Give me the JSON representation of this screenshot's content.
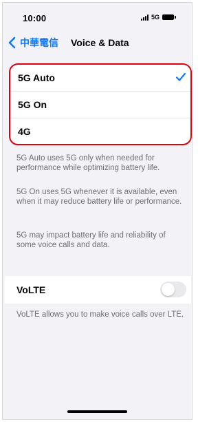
{
  "status_bar": {
    "time": "10:00",
    "network": "5G",
    "signal_icon": "signal-bars-icon",
    "battery_icon": "battery-icon"
  },
  "nav": {
    "back_label": "中華電信",
    "back_icon": "chevron-left-icon",
    "title": "Voice & Data"
  },
  "options": [
    {
      "label": "5G Auto",
      "selected": true
    },
    {
      "label": "5G On",
      "selected": false
    },
    {
      "label": "4G",
      "selected": false
    }
  ],
  "footnotes": {
    "auto": "5G Auto uses 5G only when needed for performance while optimizing battery life.",
    "on": "5G On uses 5G whenever it is available, even when it may reduce battery life or performance.",
    "impact": "5G may impact battery life and reliability of some voice calls and data."
  },
  "volte": {
    "label": "VoLTE",
    "enabled": false,
    "footnote": "VoLTE allows you to make voice calls over LTE."
  },
  "colors": {
    "accent": "#0a7aff",
    "highlight_border": "#e1000f",
    "background": "#f2f2f7",
    "footnote_text": "#6d6d72"
  }
}
